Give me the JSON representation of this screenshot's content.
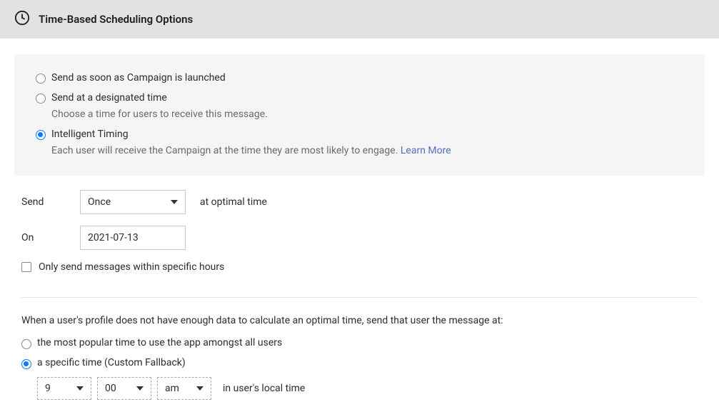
{
  "header": {
    "title": "Time-Based Scheduling Options"
  },
  "schedule_options": {
    "immediate": {
      "label": "Send as soon as Campaign is launched"
    },
    "designated": {
      "label": "Send at a designated time",
      "helper": "Choose a time for users to receive this message."
    },
    "intelligent": {
      "label": "Intelligent Timing",
      "helper": "Each user will receive the Campaign at the time they are most likely to engage. ",
      "learn_more": "Learn More"
    }
  },
  "send": {
    "label": "Send",
    "frequency": "Once",
    "suffix": "at optimal time"
  },
  "on": {
    "label": "On",
    "date": "2021-07-13"
  },
  "specific_hours": {
    "label": "Only send messages within specific hours"
  },
  "fallback": {
    "prompt": "When a user's profile does not have enough data to calculate an optimal time, send that user the message at:",
    "popular": {
      "label": "the most popular time to use the app amongst all users"
    },
    "custom": {
      "label": "a specific time (Custom Fallback)"
    },
    "time": {
      "hour": "9",
      "minute": "00",
      "ampm": "am",
      "suffix": "in user's local time"
    }
  }
}
